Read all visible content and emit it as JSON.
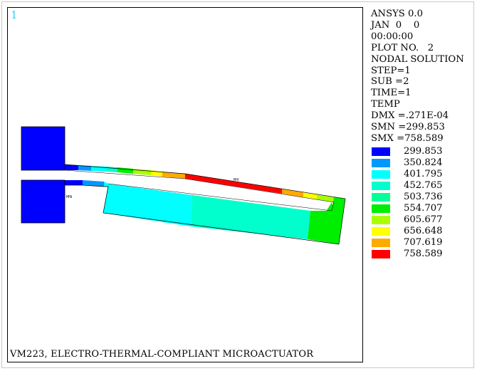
{
  "window_number": "1",
  "caption": "VM223, ELECTRO-THERMAL-COMPLIANT MICROACTUATOR",
  "info_lines": [
    "ANSYS 0.0",
    "JAN  0    0",
    "00:00:00",
    "PLOT NO.   2",
    "NODAL SOLUTION",
    "STEP=1",
    "SUB =2",
    "TIME=1",
    "TEMP",
    "DMX =.271E-04",
    "SMN =299.853",
    "SMX =758.589"
  ],
  "legend": [
    {
      "value": "299.853",
      "color": "#0000ff"
    },
    {
      "value": "350.824",
      "color": "#0099ff"
    },
    {
      "value": "401.795",
      "color": "#00ffff"
    },
    {
      "value": "452.765",
      "color": "#00ffcc"
    },
    {
      "value": "503.736",
      "color": "#00ff99"
    },
    {
      "value": "554.707",
      "color": "#00ee00"
    },
    {
      "value": "605.677",
      "color": "#aaff00"
    },
    {
      "value": "656.648",
      "color": "#ffff00"
    },
    {
      "value": "707.619",
      "color": "#ffaa00"
    },
    {
      "value": "758.589",
      "color": "#ff0000"
    }
  ],
  "markers": {
    "max": "MX",
    "min": "MN"
  }
}
